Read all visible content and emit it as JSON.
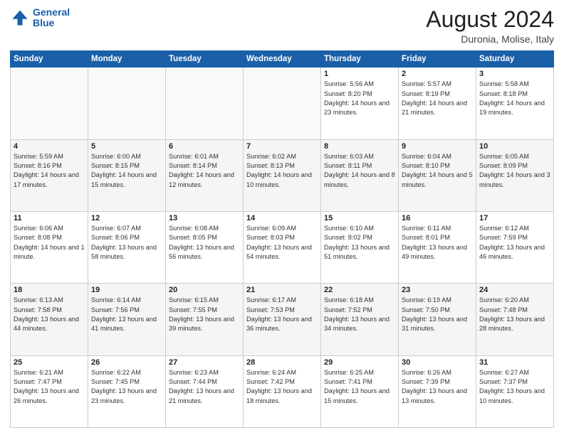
{
  "header": {
    "logo_line1": "General",
    "logo_line2": "Blue",
    "title": "August 2024",
    "location": "Duronia, Molise, Italy"
  },
  "days_of_week": [
    "Sunday",
    "Monday",
    "Tuesday",
    "Wednesday",
    "Thursday",
    "Friday",
    "Saturday"
  ],
  "weeks": [
    [
      {
        "day": "",
        "info": ""
      },
      {
        "day": "",
        "info": ""
      },
      {
        "day": "",
        "info": ""
      },
      {
        "day": "",
        "info": ""
      },
      {
        "day": "1",
        "info": "Sunrise: 5:56 AM\nSunset: 8:20 PM\nDaylight: 14 hours and 23 minutes."
      },
      {
        "day": "2",
        "info": "Sunrise: 5:57 AM\nSunset: 8:19 PM\nDaylight: 14 hours and 21 minutes."
      },
      {
        "day": "3",
        "info": "Sunrise: 5:58 AM\nSunset: 8:18 PM\nDaylight: 14 hours and 19 minutes."
      }
    ],
    [
      {
        "day": "4",
        "info": "Sunrise: 5:59 AM\nSunset: 8:16 PM\nDaylight: 14 hours and 17 minutes."
      },
      {
        "day": "5",
        "info": "Sunrise: 6:00 AM\nSunset: 8:15 PM\nDaylight: 14 hours and 15 minutes."
      },
      {
        "day": "6",
        "info": "Sunrise: 6:01 AM\nSunset: 8:14 PM\nDaylight: 14 hours and 12 minutes."
      },
      {
        "day": "7",
        "info": "Sunrise: 6:02 AM\nSunset: 8:13 PM\nDaylight: 14 hours and 10 minutes."
      },
      {
        "day": "8",
        "info": "Sunrise: 6:03 AM\nSunset: 8:11 PM\nDaylight: 14 hours and 8 minutes."
      },
      {
        "day": "9",
        "info": "Sunrise: 6:04 AM\nSunset: 8:10 PM\nDaylight: 14 hours and 5 minutes."
      },
      {
        "day": "10",
        "info": "Sunrise: 6:05 AM\nSunset: 8:09 PM\nDaylight: 14 hours and 3 minutes."
      }
    ],
    [
      {
        "day": "11",
        "info": "Sunrise: 6:06 AM\nSunset: 8:08 PM\nDaylight: 14 hours and 1 minute."
      },
      {
        "day": "12",
        "info": "Sunrise: 6:07 AM\nSunset: 8:06 PM\nDaylight: 13 hours and 58 minutes."
      },
      {
        "day": "13",
        "info": "Sunrise: 6:08 AM\nSunset: 8:05 PM\nDaylight: 13 hours and 56 minutes."
      },
      {
        "day": "14",
        "info": "Sunrise: 6:09 AM\nSunset: 8:03 PM\nDaylight: 13 hours and 54 minutes."
      },
      {
        "day": "15",
        "info": "Sunrise: 6:10 AM\nSunset: 8:02 PM\nDaylight: 13 hours and 51 minutes."
      },
      {
        "day": "16",
        "info": "Sunrise: 6:11 AM\nSunset: 8:01 PM\nDaylight: 13 hours and 49 minutes."
      },
      {
        "day": "17",
        "info": "Sunrise: 6:12 AM\nSunset: 7:59 PM\nDaylight: 13 hours and 46 minutes."
      }
    ],
    [
      {
        "day": "18",
        "info": "Sunrise: 6:13 AM\nSunset: 7:58 PM\nDaylight: 13 hours and 44 minutes."
      },
      {
        "day": "19",
        "info": "Sunrise: 6:14 AM\nSunset: 7:56 PM\nDaylight: 13 hours and 41 minutes."
      },
      {
        "day": "20",
        "info": "Sunrise: 6:15 AM\nSunset: 7:55 PM\nDaylight: 13 hours and 39 minutes."
      },
      {
        "day": "21",
        "info": "Sunrise: 6:17 AM\nSunset: 7:53 PM\nDaylight: 13 hours and 36 minutes."
      },
      {
        "day": "22",
        "info": "Sunrise: 6:18 AM\nSunset: 7:52 PM\nDaylight: 13 hours and 34 minutes."
      },
      {
        "day": "23",
        "info": "Sunrise: 6:19 AM\nSunset: 7:50 PM\nDaylight: 13 hours and 31 minutes."
      },
      {
        "day": "24",
        "info": "Sunrise: 6:20 AM\nSunset: 7:48 PM\nDaylight: 13 hours and 28 minutes."
      }
    ],
    [
      {
        "day": "25",
        "info": "Sunrise: 6:21 AM\nSunset: 7:47 PM\nDaylight: 13 hours and 26 minutes."
      },
      {
        "day": "26",
        "info": "Sunrise: 6:22 AM\nSunset: 7:45 PM\nDaylight: 13 hours and 23 minutes."
      },
      {
        "day": "27",
        "info": "Sunrise: 6:23 AM\nSunset: 7:44 PM\nDaylight: 13 hours and 21 minutes."
      },
      {
        "day": "28",
        "info": "Sunrise: 6:24 AM\nSunset: 7:42 PM\nDaylight: 13 hours and 18 minutes."
      },
      {
        "day": "29",
        "info": "Sunrise: 6:25 AM\nSunset: 7:41 PM\nDaylight: 13 hours and 15 minutes."
      },
      {
        "day": "30",
        "info": "Sunrise: 6:26 AM\nSunset: 7:39 PM\nDaylight: 13 hours and 13 minutes."
      },
      {
        "day": "31",
        "info": "Sunrise: 6:27 AM\nSunset: 7:37 PM\nDaylight: 13 hours and 10 minutes."
      }
    ]
  ]
}
